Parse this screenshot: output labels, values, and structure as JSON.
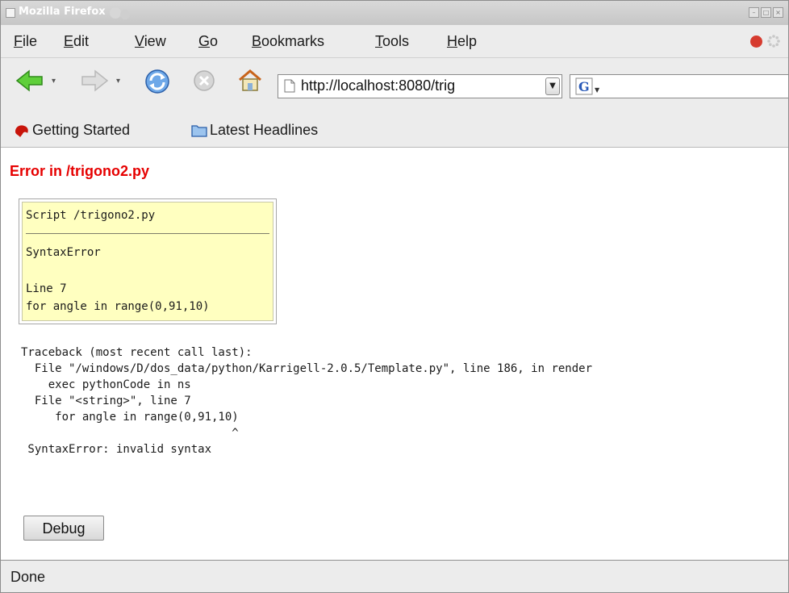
{
  "window": {
    "title": "Mozilla Firefox"
  },
  "menubar": {
    "items": [
      {
        "label": "File",
        "accel": "F",
        "rest": "ile"
      },
      {
        "label": "Edit",
        "accel": "E",
        "rest": "dit"
      },
      {
        "label": "View",
        "accel": "V",
        "rest": "iew"
      },
      {
        "label": "Go",
        "accel": "G",
        "rest": "o"
      },
      {
        "label": "Bookmarks",
        "accel": "B",
        "rest": "ookmarks"
      },
      {
        "label": "Tools",
        "accel": "T",
        "rest": "ools"
      },
      {
        "label": "Help",
        "accel": "H",
        "rest": "elp"
      }
    ]
  },
  "navbar": {
    "url": "http://localhost:8080/trig",
    "icons": [
      "back-icon",
      "forward-icon",
      "reload-icon",
      "stop-icon",
      "home-icon",
      "google-icon"
    ]
  },
  "bookmarks": {
    "items": [
      {
        "label": "Getting Started",
        "icon": "getting-started-icon"
      },
      {
        "label": "Latest Headlines",
        "icon": "folder-icon"
      }
    ]
  },
  "content": {
    "error_title": "Error in /trigono2.py",
    "box": {
      "script": "Script /trigono2.py",
      "error_type": "SyntaxError",
      "line": "Line 7",
      "code": "for angle in range(0,91,10)"
    },
    "traceback": "Traceback (most recent call last):\n  File \"/windows/D/dos_data/python/Karrigell-2.0.5/Template.py\", line 186, in render\n    exec pythonCode in ns\n  File \"<string>\", line 7\n     for angle in range(0,91,10)\n                               ^\n SyntaxError: invalid syntax",
    "debug_button": "Debug"
  },
  "status": {
    "text": "Done"
  },
  "colors": {
    "error_red": "#e60000",
    "box_yellow": "#ffffc0",
    "chrome": "#ececec"
  }
}
